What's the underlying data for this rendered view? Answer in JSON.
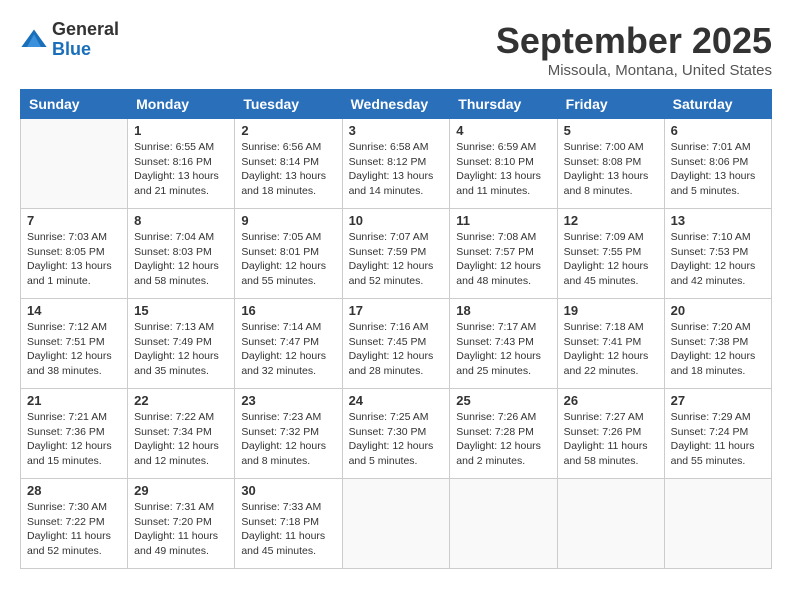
{
  "logo": {
    "general": "General",
    "blue": "Blue"
  },
  "title": "September 2025",
  "location": "Missoula, Montana, United States",
  "days_of_week": [
    "Sunday",
    "Monday",
    "Tuesday",
    "Wednesday",
    "Thursday",
    "Friday",
    "Saturday"
  ],
  "weeks": [
    [
      {
        "day": "",
        "info": ""
      },
      {
        "day": "1",
        "info": "Sunrise: 6:55 AM\nSunset: 8:16 PM\nDaylight: 13 hours\nand 21 minutes."
      },
      {
        "day": "2",
        "info": "Sunrise: 6:56 AM\nSunset: 8:14 PM\nDaylight: 13 hours\nand 18 minutes."
      },
      {
        "day": "3",
        "info": "Sunrise: 6:58 AM\nSunset: 8:12 PM\nDaylight: 13 hours\nand 14 minutes."
      },
      {
        "day": "4",
        "info": "Sunrise: 6:59 AM\nSunset: 8:10 PM\nDaylight: 13 hours\nand 11 minutes."
      },
      {
        "day": "5",
        "info": "Sunrise: 7:00 AM\nSunset: 8:08 PM\nDaylight: 13 hours\nand 8 minutes."
      },
      {
        "day": "6",
        "info": "Sunrise: 7:01 AM\nSunset: 8:06 PM\nDaylight: 13 hours\nand 5 minutes."
      }
    ],
    [
      {
        "day": "7",
        "info": "Sunrise: 7:03 AM\nSunset: 8:05 PM\nDaylight: 13 hours\nand 1 minute."
      },
      {
        "day": "8",
        "info": "Sunrise: 7:04 AM\nSunset: 8:03 PM\nDaylight: 12 hours\nand 58 minutes."
      },
      {
        "day": "9",
        "info": "Sunrise: 7:05 AM\nSunset: 8:01 PM\nDaylight: 12 hours\nand 55 minutes."
      },
      {
        "day": "10",
        "info": "Sunrise: 7:07 AM\nSunset: 7:59 PM\nDaylight: 12 hours\nand 52 minutes."
      },
      {
        "day": "11",
        "info": "Sunrise: 7:08 AM\nSunset: 7:57 PM\nDaylight: 12 hours\nand 48 minutes."
      },
      {
        "day": "12",
        "info": "Sunrise: 7:09 AM\nSunset: 7:55 PM\nDaylight: 12 hours\nand 45 minutes."
      },
      {
        "day": "13",
        "info": "Sunrise: 7:10 AM\nSunset: 7:53 PM\nDaylight: 12 hours\nand 42 minutes."
      }
    ],
    [
      {
        "day": "14",
        "info": "Sunrise: 7:12 AM\nSunset: 7:51 PM\nDaylight: 12 hours\nand 38 minutes."
      },
      {
        "day": "15",
        "info": "Sunrise: 7:13 AM\nSunset: 7:49 PM\nDaylight: 12 hours\nand 35 minutes."
      },
      {
        "day": "16",
        "info": "Sunrise: 7:14 AM\nSunset: 7:47 PM\nDaylight: 12 hours\nand 32 minutes."
      },
      {
        "day": "17",
        "info": "Sunrise: 7:16 AM\nSunset: 7:45 PM\nDaylight: 12 hours\nand 28 minutes."
      },
      {
        "day": "18",
        "info": "Sunrise: 7:17 AM\nSunset: 7:43 PM\nDaylight: 12 hours\nand 25 minutes."
      },
      {
        "day": "19",
        "info": "Sunrise: 7:18 AM\nSunset: 7:41 PM\nDaylight: 12 hours\nand 22 minutes."
      },
      {
        "day": "20",
        "info": "Sunrise: 7:20 AM\nSunset: 7:38 PM\nDaylight: 12 hours\nand 18 minutes."
      }
    ],
    [
      {
        "day": "21",
        "info": "Sunrise: 7:21 AM\nSunset: 7:36 PM\nDaylight: 12 hours\nand 15 minutes."
      },
      {
        "day": "22",
        "info": "Sunrise: 7:22 AM\nSunset: 7:34 PM\nDaylight: 12 hours\nand 12 minutes."
      },
      {
        "day": "23",
        "info": "Sunrise: 7:23 AM\nSunset: 7:32 PM\nDaylight: 12 hours\nand 8 minutes."
      },
      {
        "day": "24",
        "info": "Sunrise: 7:25 AM\nSunset: 7:30 PM\nDaylight: 12 hours\nand 5 minutes."
      },
      {
        "day": "25",
        "info": "Sunrise: 7:26 AM\nSunset: 7:28 PM\nDaylight: 12 hours\nand 2 minutes."
      },
      {
        "day": "26",
        "info": "Sunrise: 7:27 AM\nSunset: 7:26 PM\nDaylight: 11 hours\nand 58 minutes."
      },
      {
        "day": "27",
        "info": "Sunrise: 7:29 AM\nSunset: 7:24 PM\nDaylight: 11 hours\nand 55 minutes."
      }
    ],
    [
      {
        "day": "28",
        "info": "Sunrise: 7:30 AM\nSunset: 7:22 PM\nDaylight: 11 hours\nand 52 minutes."
      },
      {
        "day": "29",
        "info": "Sunrise: 7:31 AM\nSunset: 7:20 PM\nDaylight: 11 hours\nand 49 minutes."
      },
      {
        "day": "30",
        "info": "Sunrise: 7:33 AM\nSunset: 7:18 PM\nDaylight: 11 hours\nand 45 minutes."
      },
      {
        "day": "",
        "info": ""
      },
      {
        "day": "",
        "info": ""
      },
      {
        "day": "",
        "info": ""
      },
      {
        "day": "",
        "info": ""
      }
    ]
  ]
}
